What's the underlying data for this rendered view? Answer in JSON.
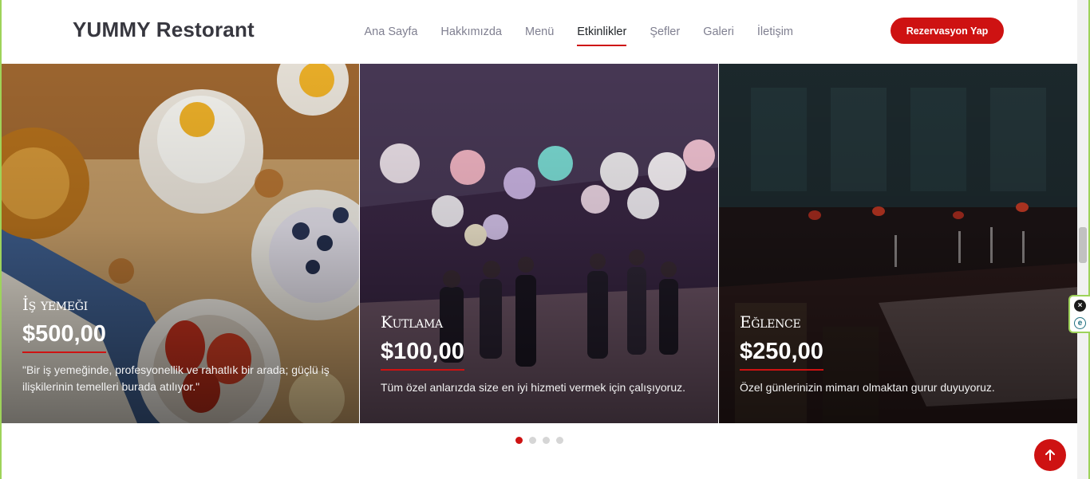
{
  "brand": "YUMMY Restorant",
  "nav": {
    "items": [
      {
        "label": "Ana Sayfa",
        "active": false
      },
      {
        "label": "Hakkımızda",
        "active": false
      },
      {
        "label": "Menü",
        "active": false
      },
      {
        "label": "Etkinlikler",
        "active": true
      },
      {
        "label": "Şefler",
        "active": false
      },
      {
        "label": "Galeri",
        "active": false
      },
      {
        "label": "İletişim",
        "active": false
      }
    ],
    "cta_label": "Rezervasyon Yap"
  },
  "events": [
    {
      "title": "İş yemeği",
      "price": "$500,00",
      "description": "\"Bir iş yemeğinde, profesyonellik ve rahatlık bir arada; güçlü iş ilişkilerinin temelleri burada atılıyor.\"",
      "image": "breakfast-table-photo"
    },
    {
      "title": "Kutlama",
      "price": "$100,00",
      "description": "Tüm özel anlarızda size en iyi hizmeti vermek için çalışıyoruz.",
      "image": "lantern-celebration-photo"
    },
    {
      "title": "Eğlence",
      "price": "$250,00",
      "description": "Özel günlerinizin mimarı olmaktan gurur duyuyoruz.",
      "image": "restaurant-dining-photo"
    }
  ],
  "pagination": {
    "count": 4,
    "active_index": 0
  },
  "icons": {
    "back_to_top": "arrow-up-icon",
    "widget_close": "close-icon",
    "widget_e": "e-icon"
  },
  "colors": {
    "accent": "#ce1212",
    "brand_text": "#37373f",
    "nav_text": "#7f7f90",
    "frame": "#9ed35a"
  }
}
